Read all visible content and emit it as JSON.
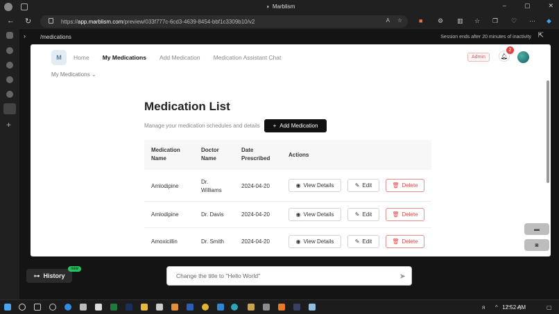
{
  "browser": {
    "tab_title": "Marblism",
    "url_prefix": "https://",
    "url_host": "app.marblism.com",
    "url_path": "/preview/033f777c-6cd3-4639-8454-bbf1c3309b10/v2",
    "read_aloud_label": "A",
    "window_controls": [
      "–",
      "▢",
      "✕"
    ]
  },
  "preview": {
    "route": "/medications",
    "session_notice": "Session ends after 20 minutes of inactivity"
  },
  "app": {
    "logo_text": "M",
    "nav": [
      "Home",
      "My Medications",
      "Add Medication",
      "Medication Assistant Chat"
    ],
    "submenu": "My Medications",
    "admin_badge": "Admin",
    "notification_count": "2",
    "page_title": "Medication List",
    "subtitle": "Manage your medication schedules and details",
    "add_button": "Add Medication",
    "table": {
      "headers": {
        "name": [
          "Medication",
          "Name"
        ],
        "doctor": [
          "Doctor",
          "Name"
        ],
        "date": [
          "Date",
          "Prescribed"
        ],
        "actions": "Actions"
      },
      "rows": [
        {
          "name": "Amlodipine",
          "doctor": [
            "Dr.",
            "Williams"
          ],
          "date": "2024-04-20"
        },
        {
          "name": "Amlodipine",
          "doctor": [
            "Dr. Davis"
          ],
          "date": "2024-04-20"
        },
        {
          "name": "Amoxicillin",
          "doctor": [
            "Dr. Smith"
          ],
          "date": "2024-04-20"
        }
      ],
      "actions": {
        "view": "View Details",
        "edit": "Edit",
        "delete": "Delete"
      }
    }
  },
  "bottom": {
    "history_label": "History",
    "new_badge": "new",
    "chat_placeholder": "Change the title to \"Hello World\""
  },
  "taskbar": {
    "time": "12:52 AM"
  },
  "colors": {
    "accent_dark": "#111111",
    "delete_red": "#e04848",
    "new_badge_green": "#22c55e"
  }
}
